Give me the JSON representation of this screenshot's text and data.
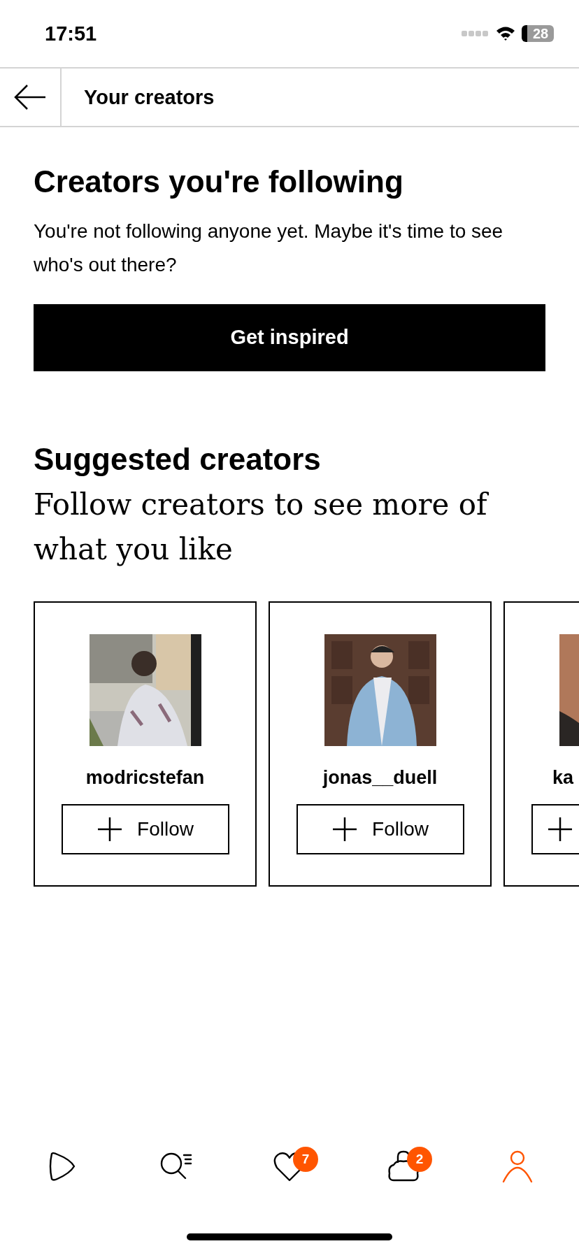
{
  "status_bar": {
    "time": "17:51",
    "battery": "28"
  },
  "header": {
    "title": "Your creators"
  },
  "following": {
    "title": "Creators you're following",
    "message": "You're not following anyone yet. Maybe it's time to see who's out there?",
    "button": "Get inspired"
  },
  "suggested": {
    "title": "Suggested creators",
    "subtitle": "Follow creators to see more of what you like",
    "creators": [
      {
        "username": "modricstefan",
        "follow": "Follow"
      },
      {
        "username": "jonas__duell",
        "follow": "Follow"
      },
      {
        "username": "ka"
      }
    ]
  },
  "nav": [
    {
      "kind": "home",
      "selected": false
    },
    {
      "kind": "search",
      "selected": false
    },
    {
      "kind": "favorites",
      "selected": false,
      "badge": "7"
    },
    {
      "kind": "bag",
      "selected": false,
      "badge": "2"
    },
    {
      "kind": "profile",
      "selected": true
    }
  ]
}
